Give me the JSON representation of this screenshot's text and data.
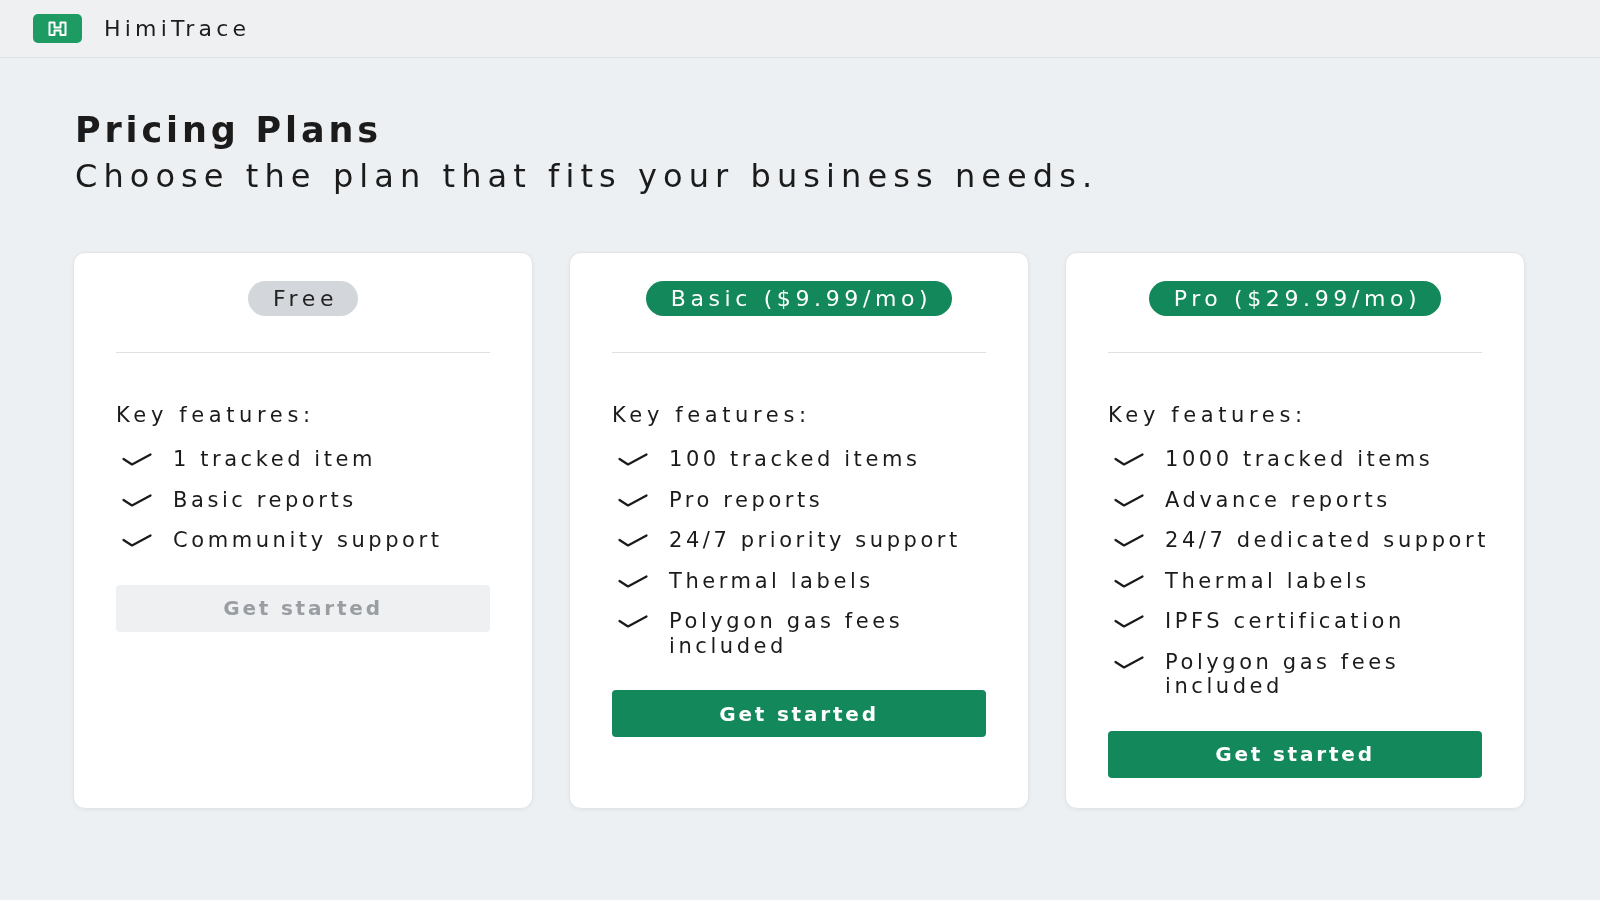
{
  "header": {
    "app_name": "HimiTrace"
  },
  "page": {
    "title": "Pricing Plans",
    "subtitle": "Choose the plan that fits your business needs."
  },
  "plans": [
    {
      "name": "Free",
      "kind": "free",
      "features_label": "Key features:",
      "features": [
        "1 tracked item",
        "Basic reports",
        "Community support"
      ],
      "button": {
        "label": "Get started",
        "disabled": true
      }
    },
    {
      "name": "Basic ($9.99/mo)",
      "kind": "paid",
      "features_label": "Key features:",
      "features": [
        "100 tracked items",
        "Pro reports",
        "24/7 priority support",
        "Thermal labels",
        "Polygon gas fees included"
      ],
      "button": {
        "label": "Get started",
        "disabled": false
      }
    },
    {
      "name": "Pro ($29.99/mo)",
      "kind": "paid",
      "features_label": "Key features:",
      "features": [
        "1000 tracked items",
        "Advance reports",
        "24/7 dedicated support",
        "Thermal labels",
        "IPFS certification",
        "Polygon gas fees included"
      ],
      "button": {
        "label": "Get started",
        "disabled": false
      }
    }
  ]
}
